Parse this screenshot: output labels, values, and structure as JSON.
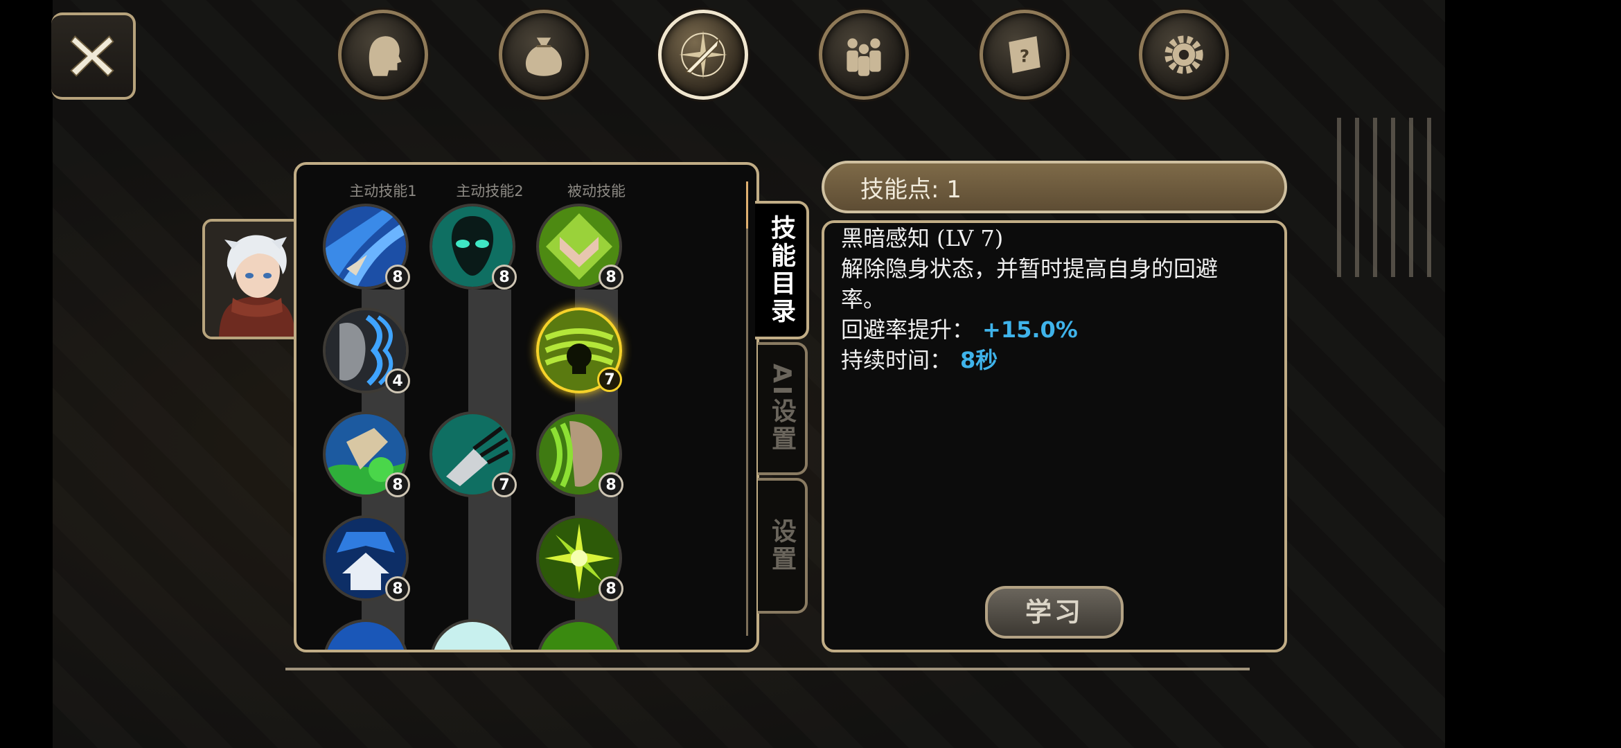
{
  "column_headers": [
    "主动技能1",
    "主动技能2",
    "被动技能"
  ],
  "side_tabs": [
    "技能目录",
    "AI设置",
    "设置"
  ],
  "skill_points": {
    "label": "技能点",
    "value": "1",
    "text": "技能点: 1"
  },
  "detail": {
    "title": "黑暗感知 (LV 7)",
    "description": "解除隐身状态，并暂时提高自身的回避率。",
    "stats": [
      {
        "label": "回避率提升：",
        "value": "+15.0%"
      },
      {
        "label": "持续时间：",
        "value": "8秒"
      }
    ]
  },
  "learn_button": "学习",
  "skills": {
    "active1": [
      "8",
      "4",
      "8",
      "8"
    ],
    "active2": [
      "8",
      "7"
    ],
    "passive": [
      "8",
      "7",
      "8",
      "8"
    ]
  },
  "icons": {
    "top_menu": [
      "character-icon",
      "bag-icon",
      "skills-icon",
      "party-icon",
      "quest-scroll-icon",
      "settings-gear-icon"
    ],
    "active_menu": "skills-icon"
  },
  "colors": {
    "accent_value": "#3fb3ea",
    "selected_border": "#f6d22a",
    "frame": "#c1ad86"
  }
}
